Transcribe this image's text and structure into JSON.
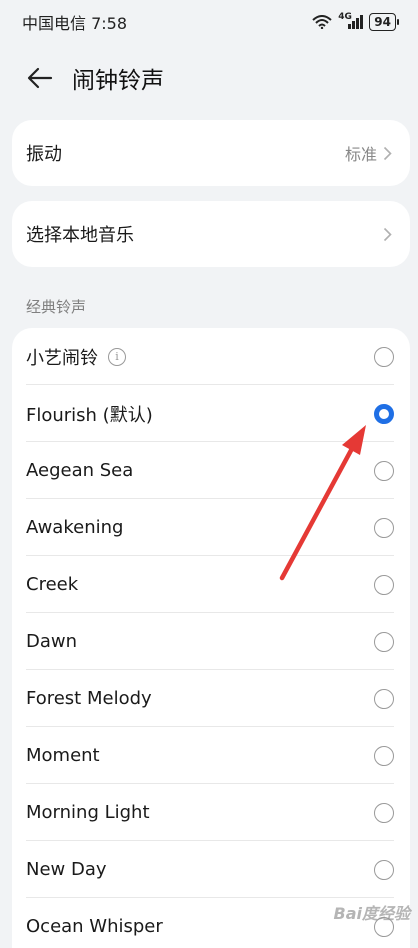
{
  "status": {
    "carrier_time": "中国电信 7:58",
    "net_type": "4G",
    "battery": "94"
  },
  "header": {
    "title": "闹钟铃声"
  },
  "settings": {
    "vibration": {
      "label": "振动",
      "value": "标准"
    },
    "local_music": {
      "label": "选择本地音乐"
    }
  },
  "classic": {
    "section_title": "经典铃声",
    "items": [
      {
        "label": "小艺闹铃",
        "info": "i",
        "checked": false
      },
      {
        "label": "Flourish (默认)",
        "checked": true
      },
      {
        "label": "Aegean Sea",
        "checked": false
      },
      {
        "label": "Awakening",
        "checked": false
      },
      {
        "label": "Creek",
        "checked": false
      },
      {
        "label": "Dawn",
        "checked": false
      },
      {
        "label": "Forest Melody",
        "checked": false
      },
      {
        "label": "Moment",
        "checked": false
      },
      {
        "label": "Morning Light",
        "checked": false
      },
      {
        "label": "New Day",
        "checked": false
      },
      {
        "label": "Ocean Whisper",
        "checked": false
      }
    ]
  },
  "colors": {
    "accent": "#1f6fe5",
    "annotation": "#e53935"
  },
  "watermark": "Bai度经验"
}
